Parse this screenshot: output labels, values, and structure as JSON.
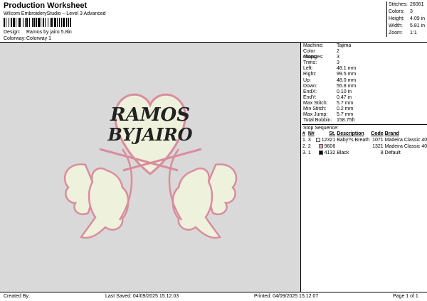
{
  "header": {
    "title": "Production Worksheet",
    "subtitle": "Wilcom EmbroideryStudio – Level 3 Advanced",
    "design_label": "Design:",
    "design_value": "Ramos by jairo 5.8in",
    "colorway_label": "Colorway:",
    "colorway_value": "Colorway 1"
  },
  "top_stats": [
    {
      "label": "Stitches:",
      "value": "26061"
    },
    {
      "label": "Colors:",
      "value": "3"
    },
    {
      "label": "Height:",
      "value": "4.09 in"
    },
    {
      "label": "Width:",
      "value": "5.81 in"
    },
    {
      "label": "Zoom:",
      "value": "1:1"
    }
  ],
  "design_text": {
    "line1": "RAMOS",
    "line2": "BYJAIRO"
  },
  "details": [
    {
      "label": "Machine:",
      "value": "Tajima"
    },
    {
      "label": "Color changes:",
      "value": "2"
    },
    {
      "label": "Stops:",
      "value": "3"
    },
    {
      "label": "Trims:",
      "value": "3"
    },
    {
      "label": "Left:",
      "value": "48.1 mm"
    },
    {
      "label": "Right:",
      "value": "99.5 mm"
    },
    {
      "label": "Up:",
      "value": "48.0 mm"
    },
    {
      "label": "Down:",
      "value": "55.8 mm"
    },
    {
      "label": "EndX:",
      "value": "0.10 in"
    },
    {
      "label": "EndY:",
      "value": "0.47 in"
    },
    {
      "label": "Max Stitch:",
      "value": "5.7 mm"
    },
    {
      "label": "Min Stitch:",
      "value": "0.2 mm"
    },
    {
      "label": "Max Jump:",
      "value": "5.7 mm"
    },
    {
      "label": "Total Bobbin:",
      "value": "158.75ft"
    }
  ],
  "stop_sequence": {
    "title": "Stop Sequence:",
    "headers": [
      "#",
      "N#",
      "St.",
      "Description",
      "Code",
      "Brand"
    ],
    "rows": [
      {
        "num": "1.",
        "needle": "3",
        "color": "#f4f4f4",
        "stitches": "12321",
        "description": "Baby?s Breath",
        "code": "1071",
        "brand": "Madeira Classic 40"
      },
      {
        "num": "2.",
        "needle": "2",
        "color": "#e6a3b0",
        "stitches": "9606",
        "description": "",
        "code": "1321",
        "brand": "Madeira Classic 40"
      },
      {
        "num": "3.",
        "needle": "1",
        "color": "#000000",
        "stitches": "4132",
        "description": "Black",
        "code": "8",
        "brand": "Default"
      }
    ]
  },
  "footer": {
    "created_by": "Created By:",
    "last_saved": "Last Saved: 04/09/2025 15.12.03",
    "printed": "Printed: 04/09/2025 15.12.07",
    "page": "Page 1 of 1"
  }
}
